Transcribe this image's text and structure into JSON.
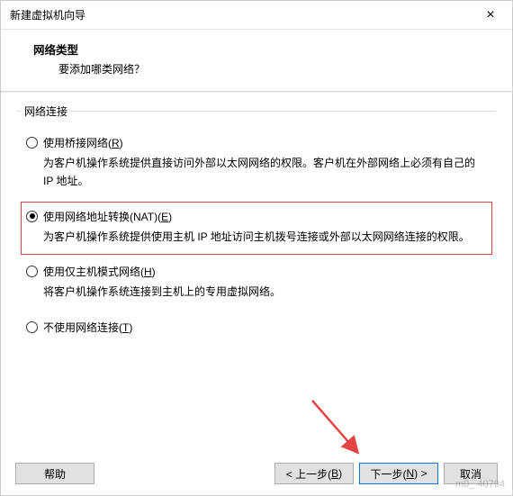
{
  "window": {
    "title": "新建虚拟机向导"
  },
  "header": {
    "heading": "网络类型",
    "subtitle": "要添加哪类网络？"
  },
  "group": {
    "legend": "网络连接",
    "options": [
      {
        "label_pre": "使用桥接网络(",
        "accel": "R",
        "label_post": ")",
        "desc": "为客户机操作系统提供直接访问外部以太网网络的权限。客户机在外部网络上必须有自己的 IP 地址。",
        "checked": false
      },
      {
        "label_pre": "使用网络地址转换(NAT)(",
        "accel": "E",
        "label_post": ")",
        "desc": "为客户机操作系统提供使用主机 IP 地址访问主机拨号连接或外部以太网网络连接的权限。",
        "checked": true,
        "highlight": true
      },
      {
        "label_pre": "使用仅主机模式网络(",
        "accel": "H",
        "label_post": ")",
        "desc": "将客户机操作系统连接到主机上的专用虚拟网络。",
        "checked": false
      },
      {
        "label_pre": "不使用网络连接(",
        "accel": "T",
        "label_post": ")",
        "desc": "",
        "checked": false
      }
    ]
  },
  "footer": {
    "help": "帮助",
    "back_pre": "< 上一步(",
    "back_accel": "B",
    "back_post": ")",
    "next_pre": "下一步(",
    "next_accel": "N",
    "next_post": ") >",
    "cancel": "取消"
  },
  "watermark": "m0_      40794"
}
